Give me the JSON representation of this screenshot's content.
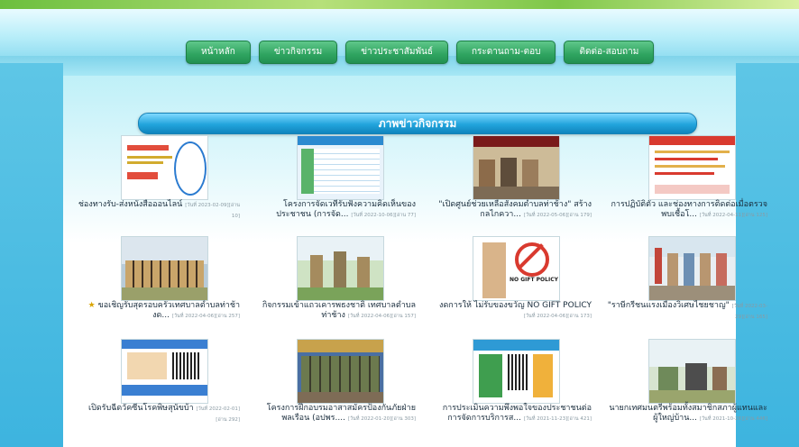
{
  "nav": {
    "items": [
      {
        "label": "หน้าหลัก"
      },
      {
        "label": "ข่าวกิจกรรม"
      },
      {
        "label": "ข่าวประชาสัมพันธ์"
      },
      {
        "label": "กระดานถาม-ตอบ"
      },
      {
        "label": "ติดต่อ-สอบถาม"
      }
    ]
  },
  "section": {
    "title": "ภาพข่าวกิจกรรม"
  },
  "news": [
    {
      "title": "ช่องทางรับ-ส่งหนังสือออนไลน์",
      "meta": "[วันที่ 2023-02-09][อ่าน 10]"
    },
    {
      "title": "โครงการจัดเวทีรับฟังความคิดเห็นของประชาชน (การจัด...",
      "meta": "[วันที่ 2022-10-06][อ่าน 77]"
    },
    {
      "title": "\"เปิดศูนย์ช่วยเหลือสังคมตำบลท่าช้าง\" สร้างกลไกควา...",
      "meta": "[วันที่ 2022-05-06][อ่าน 179]"
    },
    {
      "title": "การปฏิบัติตัว และช่องทางการติดต่อเมื่อตรวจพบเชื้อโ...",
      "meta": "[วันที่ 2022-04-11][อ่าน 125]"
    },
    {
      "title": "ขอเชิญรับสุดรอบครัวเทศบาลตำบลท่าช้างด...",
      "meta": "[วันที่ 2022-04-06][อ่าน 257]"
    },
    {
      "title": "กิจกรรมเข้าแถวเคารพธงชาติ เทศบาลตำบลท่าช้าง",
      "meta": "[วันที่ 2022-04-06][อ่าน 157]"
    },
    {
      "title": "งดการให้ ไม่รับของขวัญ NO GIFT POLICY",
      "meta": "[วันที่ 2022-04-06][อ่าน 173]"
    },
    {
      "title": "\"ราษีกรีชนแรงเมืองวิเศษไชยชาญ\"",
      "meta": "[วันที่ 2022-03-29][อ่าน 165]"
    },
    {
      "title": "เปิดรับฉีดวัคซีนโรคพิษสุนัขบ้า",
      "meta": "[วันที่ 2022-02-01][อ่าน 292]"
    },
    {
      "title": "โครงการฝึกอบรมอาสาสมัครป้องกันภัยฝ่ายพลเรือน (อปพร....",
      "meta": "[วันที่ 2022-01-20][อ่าน 303]"
    },
    {
      "title": "การประเมินความพึงพอใจของประชาชนต่อการจัดการบริการส...",
      "meta": "[วันที่ 2021-11-23][อ่าน 421]"
    },
    {
      "title": "นายกเทศมนตรีพร้อมทั้งสมาชิกสภาผู้แทนและผู้ใหญ่บ้าน...",
      "meta": "[วันที่ 2021-10-26][อ่าน 446]"
    }
  ],
  "thumbs": [
    {
      "text": "ช่องทางส่งหนังสือ",
      "theme": "#e24d3c"
    },
    {
      "text": "",
      "theme": "#2b8ad0"
    },
    {
      "text": "",
      "theme": "#c7b490"
    },
    {
      "text": "",
      "theme": "#f2b24a"
    },
    {
      "text": "",
      "theme": "#c9a56a"
    },
    {
      "text": "",
      "theme": "#9fb07a"
    },
    {
      "text": "NO GIFT POLICY",
      "theme": "#d93a2f"
    },
    {
      "text": "",
      "theme": "#b89670"
    },
    {
      "text": "",
      "theme": "#3a7fd2"
    },
    {
      "text": "",
      "theme": "#6c7a4e"
    },
    {
      "text": "",
      "theme": "#2e9ad5"
    },
    {
      "text": "",
      "theme": "#6f8a5a"
    }
  ]
}
